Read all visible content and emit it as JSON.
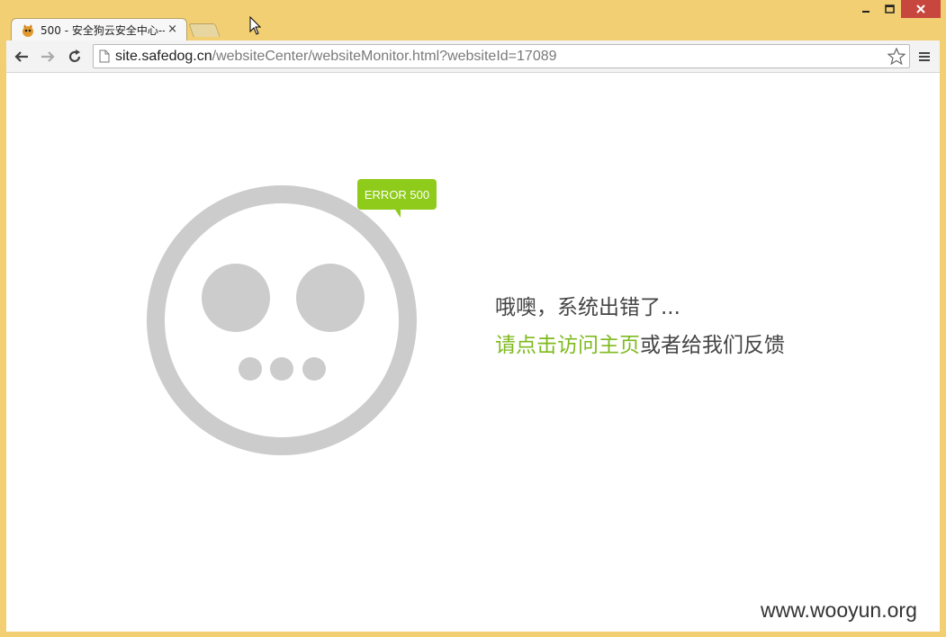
{
  "window": {
    "controls": [
      "minimize-icon",
      "maximize-icon",
      "close-icon"
    ],
    "frame_color": "#f2cf72",
    "close_color": "#c7463e"
  },
  "tab": {
    "title": "500 - 安全狗云安全中心--",
    "favicon": "safedog-favicon-icon",
    "close_label": "×"
  },
  "toolbar": {
    "back_icon": "back-arrow-icon",
    "forward_icon": "forward-arrow-icon",
    "reload_icon": "reload-icon",
    "url_host": "site.safedog.cn",
    "url_path": "/websiteCenter/websiteMonitor.html?websiteId=17089",
    "bookmark_icon": "star-icon",
    "menu_icon": "menu-icon"
  },
  "page": {
    "error_badge": "ERROR 500",
    "accent_color": "#8ecb1a",
    "face_color": "#cccccc",
    "message_line1": "哦噢，系统出错了...",
    "link_text": "请点击访问主页",
    "message_line2_rest": "或者给我们反馈"
  },
  "watermark": "www.wooyun.org"
}
